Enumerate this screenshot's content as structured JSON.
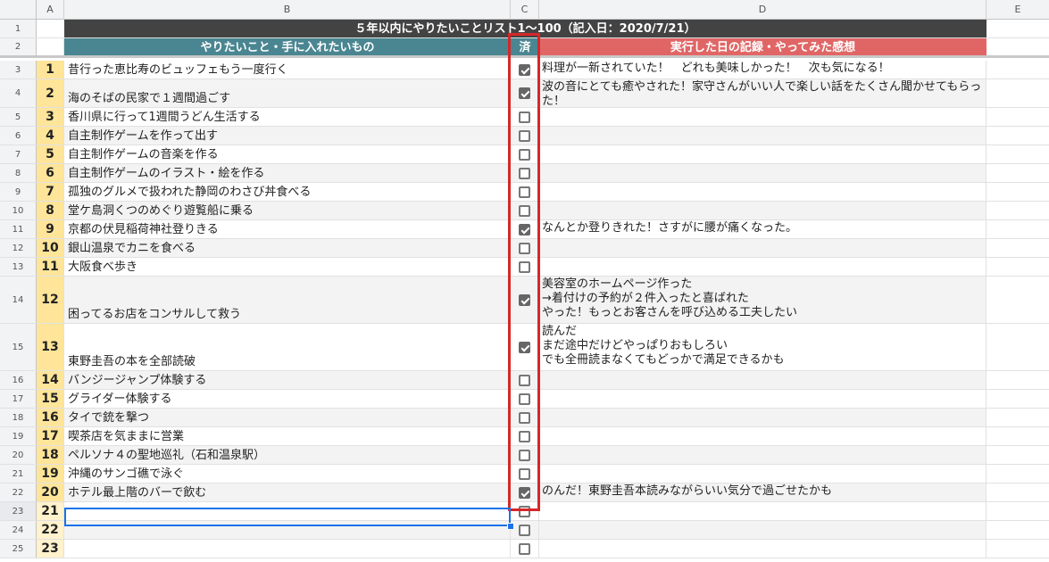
{
  "columns": [
    "A",
    "B",
    "C",
    "D",
    "E"
  ],
  "title": "５年以内にやりたいことリスト1〜100（記入日：2020/7/21）",
  "headers": {
    "wish": "やりたいこと・手に入れたいもの",
    "done": "済",
    "record": "実行した日の記録・やってみた感想"
  },
  "items": [
    {
      "row": "3",
      "num": "1",
      "wish": "昔行った恵比寿のビュッフェもう一度行く",
      "done": true,
      "note": "料理が一新されていた！　どれも美味しかった！　次も気になる！"
    },
    {
      "row": "4",
      "num": "2",
      "wish": "海のそばの民家で１週間過ごす",
      "done": true,
      "note": "波の音にとても癒やされた！家守さんがいい人で楽しい話をたくさん聞かせてもらった！"
    },
    {
      "row": "5",
      "num": "3",
      "wish": "香川県に行って1週間うどん生活する",
      "done": false,
      "note": ""
    },
    {
      "row": "6",
      "num": "4",
      "wish": "自主制作ゲームを作って出す",
      "done": false,
      "note": ""
    },
    {
      "row": "7",
      "num": "5",
      "wish": "自主制作ゲームの音楽を作る",
      "done": false,
      "note": ""
    },
    {
      "row": "8",
      "num": "6",
      "wish": "自主制作ゲームのイラスト・絵を作る",
      "done": false,
      "note": ""
    },
    {
      "row": "9",
      "num": "7",
      "wish": "孤独のグルメで扱われた静岡のわさび丼食べる",
      "done": false,
      "note": ""
    },
    {
      "row": "10",
      "num": "8",
      "wish": "堂ケ島洞くつのめぐり遊覧船に乗る",
      "done": false,
      "note": ""
    },
    {
      "row": "11",
      "num": "9",
      "wish": "京都の伏見稲荷神社登りきる",
      "done": true,
      "note": "なんとか登りきれた！さすがに腰が痛くなった。"
    },
    {
      "row": "12",
      "num": "10",
      "wish": "銀山温泉でカニを食べる",
      "done": false,
      "note": ""
    },
    {
      "row": "13",
      "num": "11",
      "wish": "大阪食べ歩き",
      "done": false,
      "note": ""
    },
    {
      "row": "14",
      "num": "12",
      "wish": "困ってるお店をコンサルして救う",
      "done": true,
      "note": "美容室のホームページ作った\n→着付けの予約が２件入ったと喜ばれた\nやった！もっとお客さんを呼び込める工夫したい"
    },
    {
      "row": "15",
      "num": "13",
      "wish": "東野圭吾の本を全部読破",
      "done": true,
      "note": "読んだ\nまだ途中だけどやっぱりおもしろい\nでも全冊読まなくてもどっかで満足できるかも"
    },
    {
      "row": "16",
      "num": "14",
      "wish": "バンジージャンプ体験する",
      "done": false,
      "note": ""
    },
    {
      "row": "17",
      "num": "15",
      "wish": "グライダー体験する",
      "done": false,
      "note": ""
    },
    {
      "row": "18",
      "num": "16",
      "wish": "タイで銃を撃つ",
      "done": false,
      "note": ""
    },
    {
      "row": "19",
      "num": "17",
      "wish": "喫茶店を気ままに営業",
      "done": false,
      "note": ""
    },
    {
      "row": "20",
      "num": "18",
      "wish": "ペルソナ４の聖地巡礼（石和温泉駅）",
      "done": false,
      "note": ""
    },
    {
      "row": "21",
      "num": "19",
      "wish": "沖縄のサンゴ礁で泳ぐ",
      "done": false,
      "note": ""
    },
    {
      "row": "22",
      "num": "20",
      "wish": "ホテル最上階のバーで飲む",
      "done": true,
      "note": "のんだ！東野圭吾本読みながらいい気分で過ごせたかも"
    },
    {
      "row": "23",
      "num": "21",
      "wish": "",
      "done": false,
      "note": ""
    },
    {
      "row": "24",
      "num": "22",
      "wish": "",
      "done": false,
      "note": ""
    },
    {
      "row": "25",
      "num": "23",
      "wish": "",
      "done": false,
      "note": ""
    }
  ]
}
